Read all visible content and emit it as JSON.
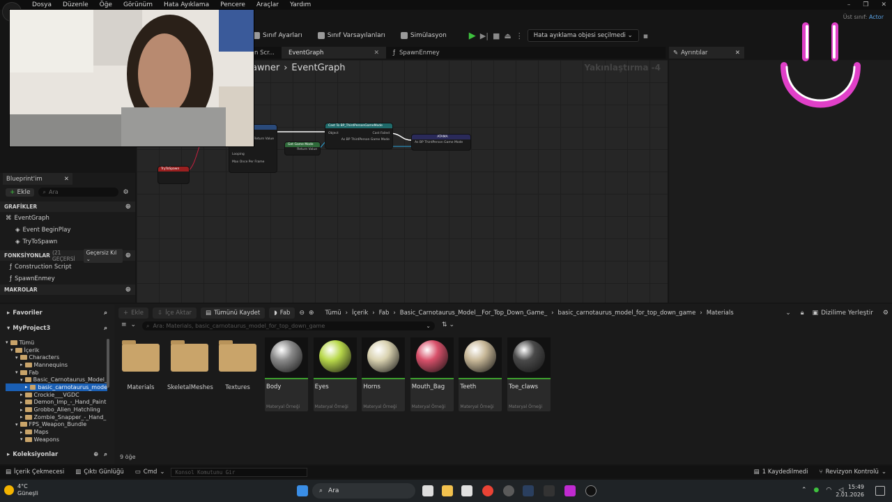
{
  "menu": [
    "Dosya",
    "Düzenle",
    "Öğe",
    "Görünüm",
    "Hata Ayıklama",
    "Pencere",
    "Araçlar",
    "Yardım"
  ],
  "parent_class": {
    "label": "Üst sınıf:",
    "value": "Actor"
  },
  "toolbar": {
    "class_settings": "Sınıf Ayarları",
    "class_defaults": "Sınıf Varsayılanları",
    "simulation": "Simülasyon",
    "debug_select": "Hata ayıklama objesi seçilmedi"
  },
  "tabs": [
    {
      "label": "n Scr..."
    },
    {
      "label": "EventGraph"
    },
    {
      "label": "SpawnEnmey"
    }
  ],
  "details_tab": "Ayrıntılar",
  "graph": {
    "breadcrumb_parent": "awner",
    "breadcrumb_current": "EventGraph",
    "zoom": "Yakınlaştırma -4",
    "nodes": {
      "cast_title": "Cast To BP_ThirdPersonGameMode",
      "cast_object": "Object",
      "cast_failed": "Cast Failed",
      "cast_as": "As BP ThirdPerson Game Mode",
      "get_game_mode": "Get Game Mode",
      "return_value": "Return Value",
      "assign_title": "ATAMA",
      "assign_pin": "As BP ThirdPerson Game Mode",
      "try_to_spawn": "TryToSpawn",
      "looping": "Looping",
      "max_once": "Max Once Per Frame",
      "time": "Time"
    }
  },
  "blueprint_panel": {
    "tab": "Blueprint'im",
    "add": "Ekle",
    "search_placeholder": "Ara",
    "graphs_header": "GRAFİKLER",
    "graphs": [
      "EventGraph",
      "Event BeginPlay",
      "TryToSpawn"
    ],
    "functions_header": "FONKSİYONLAR",
    "functions_count": "(21 GEÇERSİ",
    "override": "Geçersiz Kıl",
    "functions": [
      "Construction Script",
      "SpawnEnmey"
    ],
    "macros_header": "MAKROLAR"
  },
  "content_browser": {
    "favorites": "Favoriler",
    "project": "MyProject3",
    "collections": "Koleksiyonlar",
    "tree": [
      {
        "label": "Tümü",
        "depth": 0,
        "open": true
      },
      {
        "label": "İçerik",
        "depth": 1,
        "open": true
      },
      {
        "label": "Characters",
        "depth": 2,
        "open": true
      },
      {
        "label": "Mannequins",
        "depth": 3,
        "open": false
      },
      {
        "label": "Fab",
        "depth": 2,
        "open": true
      },
      {
        "label": "Basic_Carnotaurus_Model_",
        "depth": 3,
        "open": true
      },
      {
        "label": "basic_carnotaurus_mode",
        "depth": 4,
        "open": false,
        "selected": true
      },
      {
        "label": "Crockie___VGDC",
        "depth": 3,
        "open": false
      },
      {
        "label": "Demon_Imp_-_Hand_Paint",
        "depth": 3,
        "open": false
      },
      {
        "label": "Grobbo_Alien_Hatchling",
        "depth": 3,
        "open": false
      },
      {
        "label": "Zombie_Snapper_-_Hand_",
        "depth": 3,
        "open": false
      },
      {
        "label": "FPS_Weapon_Bundle",
        "depth": 2,
        "open": true
      },
      {
        "label": "Maps",
        "depth": 3,
        "open": false
      },
      {
        "label": "Weapons",
        "depth": 3,
        "open": true
      }
    ],
    "buttons": {
      "add": "Ekle",
      "import": "İçe Aktar",
      "save_all": "Tümünü Kaydet",
      "fab": "Fab"
    },
    "path": [
      "Tümü",
      "İçerik",
      "Fab",
      "Basic_Carnotaurus_Model__For_Top_Down_Game_",
      "basic_carnotaurus_model_for_top_down_game",
      "Materials"
    ],
    "dock_label": "Dizilime Yerleştir",
    "search_placeholder": "Ara: Materials, basic_carnotaurus_model_for_top_down_game",
    "folders": [
      "Materials",
      "SkeletalMeshes",
      "Textures"
    ],
    "materials": [
      {
        "name": "Body",
        "kind": "Materyal Örneği",
        "color": "#8a8a8a"
      },
      {
        "name": "Eyes",
        "kind": "Materyal Örneği",
        "color": "#b8d84a"
      },
      {
        "name": "Horns",
        "kind": "Materyal Örneği",
        "color": "#d9d2b0"
      },
      {
        "name": "Mouth_Bag",
        "kind": "Materyal Örneği",
        "color": "#d8506a"
      },
      {
        "name": "Teeth",
        "kind": "Materyal Örneği",
        "color": "#c8b898"
      },
      {
        "name": "Toe_claws",
        "kind": "Materyal Örneği",
        "color": "#4a4a4a"
      }
    ],
    "item_count": "9 öğe"
  },
  "status": {
    "content_drawer": "İçerik Çekmecesi",
    "output_log": "Çıktı Günlüğü",
    "cmd": "Cmd",
    "console_placeholder": "Konsol Komutunu Gir",
    "unsaved": "1 Kaydedilmedi",
    "revision": "Revizyon Kontrolü"
  },
  "taskbar": {
    "temperature": "4°C",
    "weather": "Güneşli",
    "search": "Ara",
    "time": "15:49",
    "date": "2.01.2026"
  },
  "colors": {
    "accent": "#1a5fb4",
    "smiley": "#e040c8",
    "play": "#3ec13e"
  }
}
